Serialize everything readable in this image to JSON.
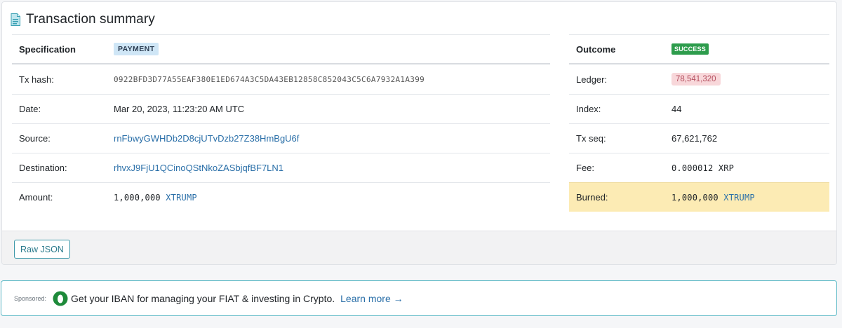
{
  "summary": {
    "title": "Transaction summary",
    "icon": "document-icon"
  },
  "specification": {
    "header_label": "Specification",
    "type_badge": "PAYMENT",
    "rows": [
      {
        "label": "Tx hash:",
        "value": "0922BFD3D77A55EAF380E1ED674A3C5DA43EB12858C852043C5C6A7932A1A399"
      },
      {
        "label": "Date:",
        "value": "Mar 20, 2023, 11:23:20 AM UTC"
      },
      {
        "label": "Source:",
        "value": "rnFbwyGWHDb2D8cjUTvDzb27Z38HmBgU6f"
      },
      {
        "label": "Destination:",
        "value": "rhvxJ9FjU1QCinoQStNkoZASbjqfBF7LN1"
      },
      {
        "label": "Amount:",
        "amount": "1,000,000",
        "currency": "XTRUMP"
      }
    ]
  },
  "outcome": {
    "header_label": "Outcome",
    "status_badge": "SUCCESS",
    "rows": [
      {
        "label": "Ledger:",
        "value": "78,541,320"
      },
      {
        "label": "Index:",
        "value": "44"
      },
      {
        "label": "Tx seq:",
        "value": "67,621,762"
      },
      {
        "label": "Fee:",
        "value": "0.000012 XRP"
      },
      {
        "label": "Burned:",
        "amount": "1,000,000",
        "currency": "XTRUMP"
      }
    ]
  },
  "footer": {
    "raw_json_label": "Raw JSON"
  },
  "sponsor": {
    "label": "Sponsored:",
    "text": "Get your IBAN for managing your FIAT & investing in Crypto.",
    "link_text": "Learn more →"
  },
  "colors": {
    "link": "#2a6fa8",
    "success": "#2d9c4c",
    "burned_bg": "#fcebb4",
    "ledger_bg": "#f8d7da",
    "accent_border": "#5db9c6"
  }
}
